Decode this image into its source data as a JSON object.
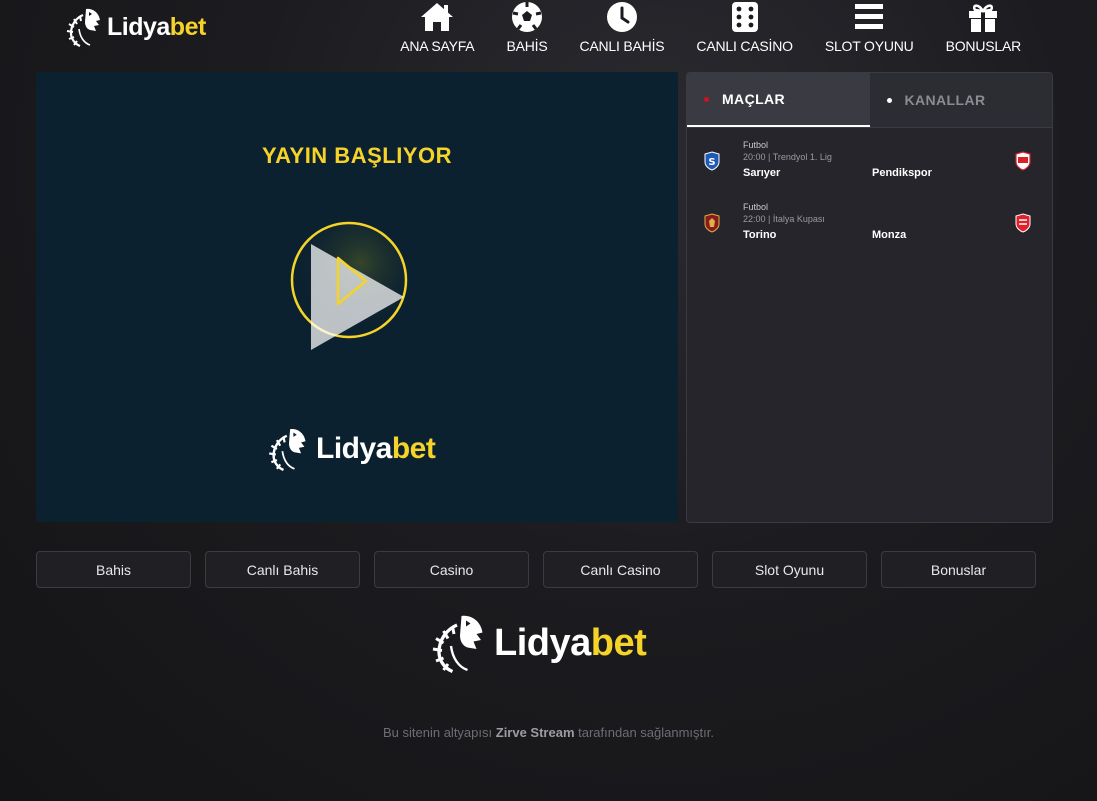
{
  "brand": {
    "name_part1": "Lidya",
    "name_part2": "bet",
    "accent": "#f5d328"
  },
  "nav": [
    {
      "label": "ANA SAYFA",
      "icon": "home-icon"
    },
    {
      "label": "BAHİS",
      "icon": "soccer-ball-icon"
    },
    {
      "label": "CANLI BAHİS",
      "icon": "clock-icon"
    },
    {
      "label": "CANLI CASİNO",
      "icon": "dice-icon"
    },
    {
      "label": "SLOT OYUNU",
      "icon": "menu-icon"
    },
    {
      "label": "BONUSLAR",
      "icon": "gift-icon"
    }
  ],
  "player": {
    "title": "YAYIN BAŞLIYOR",
    "play_icon": "play-icon"
  },
  "panel": {
    "tabs": [
      {
        "label": "MAÇLAR",
        "active": true
      },
      {
        "label": "KANALLAR",
        "active": false
      }
    ],
    "matches": [
      {
        "sport": "Futbol",
        "meta": "20:00 | Trendyol 1. Lig",
        "home": "Sarıyer",
        "away": "Pendikspor"
      },
      {
        "sport": "Futbol",
        "meta": "22:00 | İtalya Kupası",
        "home": "Torino",
        "away": "Monza"
      }
    ]
  },
  "buttons": [
    "Bahis",
    "Canlı Bahis",
    "Casino",
    "Canlı Casino",
    "Slot Oyunu",
    "Bonuslar"
  ],
  "footer": {
    "credit_pre": "Bu sitenin altyapısı",
    "credit_brand": "Zirve Stream",
    "credit_post": "tarafından sağlanmıştır."
  }
}
